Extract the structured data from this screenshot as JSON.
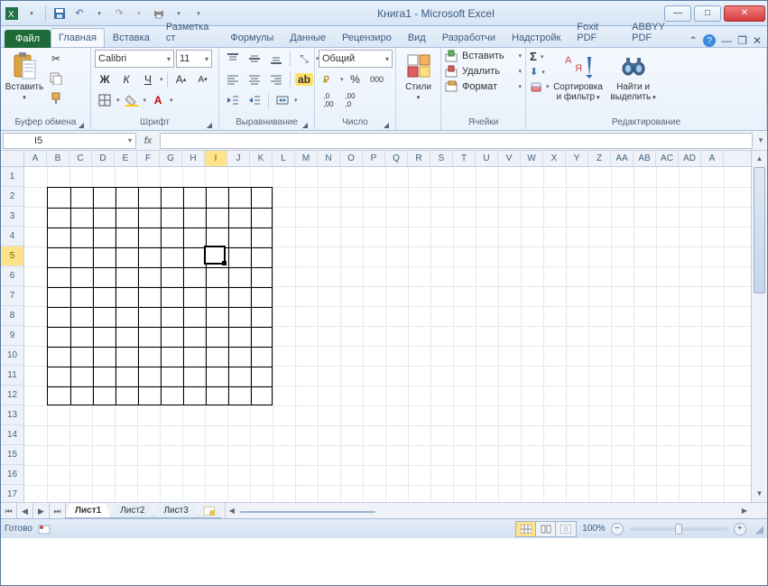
{
  "window": {
    "title": "Книга1  -  Microsoft Excel"
  },
  "ribbon": {
    "file_label": "Файл",
    "tabs": [
      "Главная",
      "Вставка",
      "Разметка ст",
      "Формулы",
      "Данные",
      "Рецензиро",
      "Вид",
      "Разработчи",
      "Надстройк",
      "Foxit PDF",
      "ABBYY PDF"
    ],
    "active_tab": 0,
    "groups": {
      "clipboard": {
        "label": "Буфер обмена",
        "paste": "Вставить"
      },
      "font": {
        "label": "Шрифт",
        "name": "Calibri",
        "size": "11",
        "bold": "Ж",
        "italic": "К",
        "underline": "Ч"
      },
      "alignment": {
        "label": "Выравнивание"
      },
      "number": {
        "label": "Число",
        "format": "Общий"
      },
      "styles": {
        "label": "",
        "button": "Стили"
      },
      "cells": {
        "label": "Ячейки",
        "insert": "Вставить",
        "delete": "Удалить",
        "format": "Формат"
      },
      "editing": {
        "label": "Редактирование",
        "sort": "Сортировка и фильтр",
        "find": "Найти и выделить"
      }
    }
  },
  "namebox": "I5",
  "sheet": {
    "columns": [
      "A",
      "B",
      "C",
      "D",
      "E",
      "F",
      "G",
      "H",
      "I",
      "J",
      "K",
      "L",
      "M",
      "N",
      "O",
      "P",
      "Q",
      "R",
      "S",
      "T",
      "U",
      "V",
      "W",
      "X",
      "Y",
      "Z",
      "AA",
      "AB",
      "AC",
      "AD",
      "A"
    ],
    "rows": [
      1,
      2,
      3,
      4,
      5,
      6,
      7,
      8,
      9,
      10,
      11,
      12,
      13,
      14,
      15,
      16,
      17
    ],
    "selected_col": "I",
    "selected_row": 5,
    "tabs": [
      "Лист1",
      "Лист2",
      "Лист3"
    ],
    "active_tab": 0
  },
  "status": {
    "ready": "Готово",
    "zoom": "100%"
  }
}
